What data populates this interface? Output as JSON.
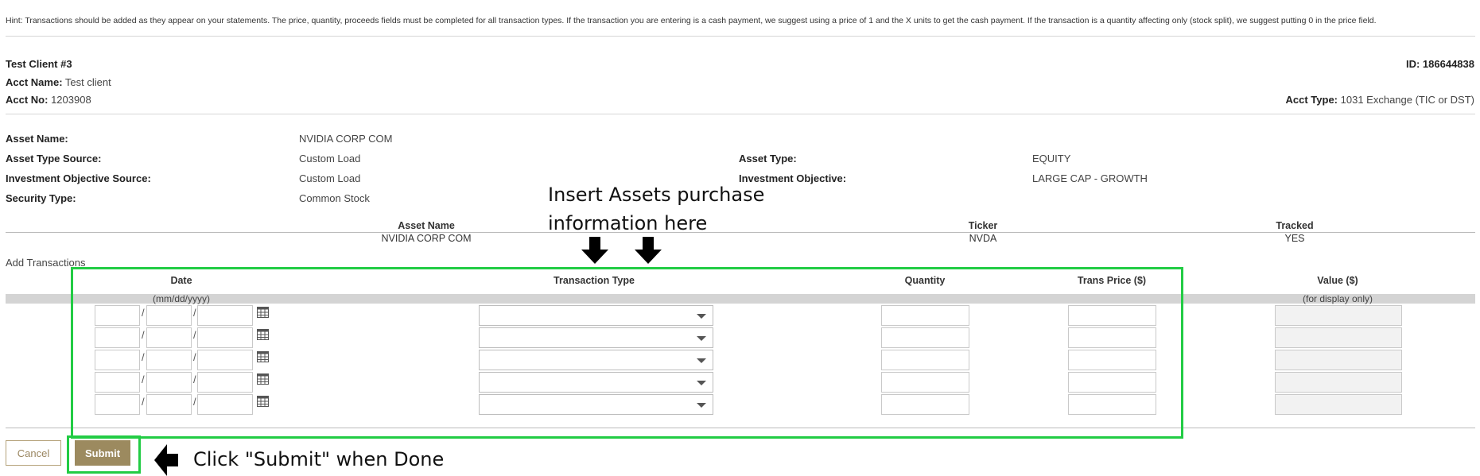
{
  "hint": "Hint: Transactions should be added as they appear on your statements. The price, quantity, proceeds fields must be completed for all transaction types. If the transaction you are entering is a cash payment, we suggest using a price of 1 and the X units to get the cash payment. If the transaction is a quantity affecting only (stock split), we suggest putting 0 in the price field.",
  "client": {
    "name": "Test Client #3",
    "id_label": "ID:",
    "id_value": "186644838",
    "acct_name_label": "Acct Name:",
    "acct_name_value": "Test client",
    "acct_no_label": "Acct No:",
    "acct_no_value": "1203908",
    "acct_type_label": "Acct Type:",
    "acct_type_value": "1031 Exchange (TIC or DST)"
  },
  "asset_details": {
    "asset_name_label": "Asset Name:",
    "asset_name_value": "NVIDIA CORP COM",
    "asset_type_source_label": "Asset Type Source:",
    "asset_type_source_value": "Custom Load",
    "asset_type_label": "Asset Type:",
    "asset_type_value": "EQUITY",
    "investment_objective_source_label": "Investment Objective Source:",
    "investment_objective_source_value": "Custom Load",
    "investment_objective_label": "Investment Objective:",
    "investment_objective_value": "LARGE CAP - GROWTH",
    "security_type_label": "Security Type:",
    "security_type_value": "Common Stock"
  },
  "asset_table": {
    "headers": [
      "Asset Name",
      "Ticker",
      "Tracked"
    ],
    "row": [
      "NVIDIA CORP COM",
      "NVDA",
      "YES"
    ]
  },
  "transactions": {
    "section_label": "Add Transactions",
    "headers": {
      "date": "Date",
      "type": "Transaction Type",
      "quantity": "Quantity",
      "price": "Trans Price ($)",
      "value": "Value ($)"
    },
    "date_hint": "(mm/dd/yyyy)",
    "value_hint": "(for display only)",
    "date_separator": "/"
  },
  "buttons": {
    "cancel": "Cancel",
    "submit": "Submit"
  },
  "annotations": {
    "insert_line1": "Insert Assets purchase",
    "insert_line2": "information here",
    "submit_note": "Click \"Submit\" when Done"
  },
  "colors": {
    "highlight": "#22cc44",
    "submit_bg": "#9c8a5f",
    "cancel_text": "#9a8660"
  }
}
